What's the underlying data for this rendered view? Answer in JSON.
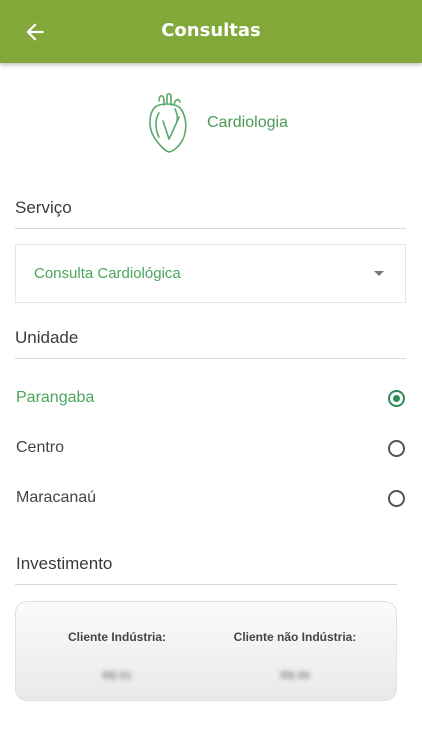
{
  "header": {
    "title": "Consultas"
  },
  "specialty": {
    "name": "Cardiologia",
    "icon": "heart-organ-icon"
  },
  "servico": {
    "label": "Serviço",
    "selected": "Consulta Cardiológica"
  },
  "unidade": {
    "label": "Unidade",
    "options": [
      {
        "label": "Parangaba",
        "selected": true
      },
      {
        "label": "Centro",
        "selected": false
      },
      {
        "label": "Maracanaú",
        "selected": false
      }
    ]
  },
  "investimento": {
    "label": "Investimento",
    "cliente_industria": {
      "label": "Cliente Indústria:",
      "price": "R$ 01"
    },
    "cliente_nao_industria": {
      "label": "Cliente não Indústria:",
      "price": "R$ 00"
    }
  },
  "colors": {
    "appbar": "#82a83a",
    "accent_green": "#4aa55a",
    "radio_selected": "#2e8b57"
  }
}
